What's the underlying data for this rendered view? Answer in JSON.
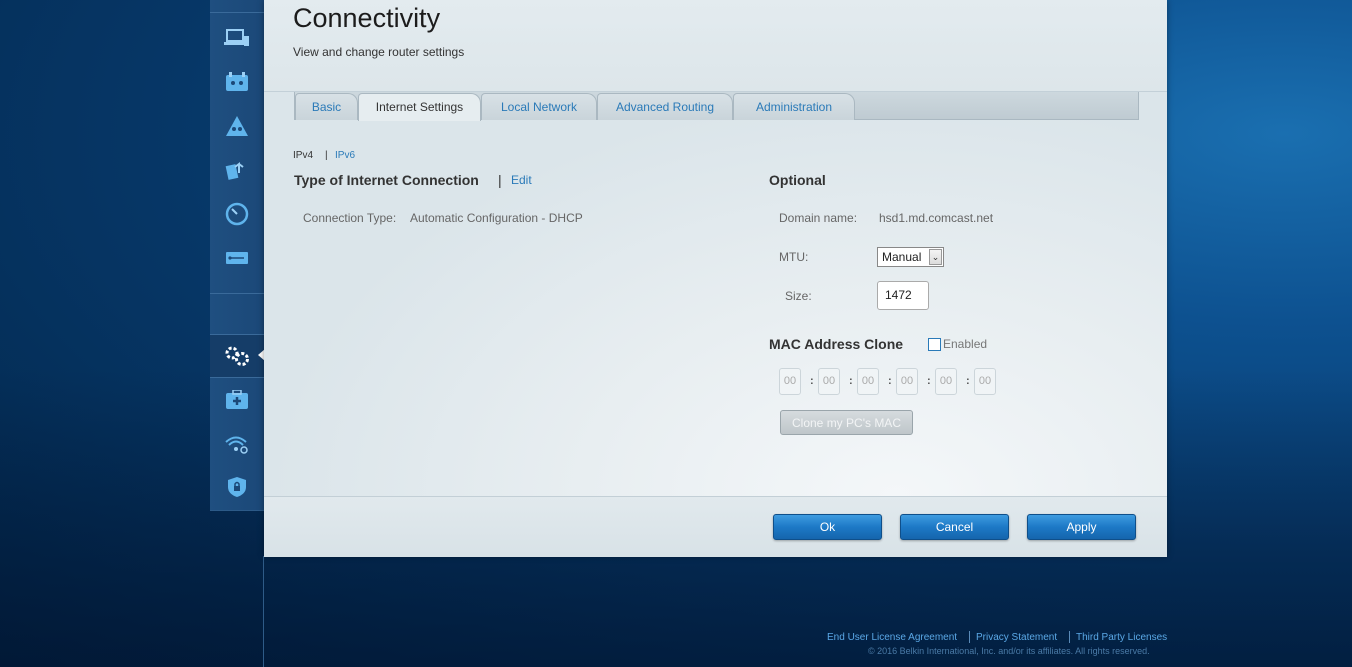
{
  "header": {
    "title": "Connectivity",
    "subtitle": "View and change router settings"
  },
  "tabs": [
    "Basic",
    "Internet Settings",
    "Local Network",
    "Advanced Routing",
    "Administration"
  ],
  "active_tab": "Internet Settings",
  "ip_versions": {
    "ipv4": "IPv4",
    "separator": "|",
    "ipv6": "IPv6"
  },
  "left": {
    "section_title": "Type of Internet Connection",
    "separator": "|",
    "edit_link": "Edit",
    "connection_type_label": "Connection Type:",
    "connection_type_value": "Automatic Configuration - DHCP"
  },
  "optional": {
    "section_title": "Optional",
    "domain_label": "Domain name:",
    "domain_value": "hsd1.md.comcast.net",
    "mtu_label": "MTU:",
    "mtu_value": "Manual",
    "size_label": "Size:",
    "size_value": "1472"
  },
  "mac_clone": {
    "section_title": "MAC Address Clone",
    "enabled_label": "Enabled",
    "enabled": false,
    "octets": [
      "00",
      "00",
      "00",
      "00",
      "00",
      "00"
    ],
    "separator": ":",
    "clone_button": "Clone my PC's MAC"
  },
  "buttons": {
    "ok": "Ok",
    "cancel": "Cancel",
    "apply": "Apply"
  },
  "sidebar_icons": [
    "devices-icon",
    "parental-controls-icon",
    "guest-network-icon",
    "media-prioritization-icon",
    "speed-test-icon",
    "usb-storage-icon",
    "connectivity-icon",
    "troubleshooting-icon",
    "wireless-icon",
    "security-icon"
  ],
  "footer": {
    "eula": "End User License Agreement",
    "privacy": "Privacy Statement",
    "third_party": "Third Party Licenses",
    "copyright": "© 2016 Belkin International, Inc. and/or its affiliates. All rights reserved."
  },
  "colors": {
    "accent": "#2a7ab8",
    "button_blue": "#1d79c6",
    "background": "#0d5190"
  }
}
